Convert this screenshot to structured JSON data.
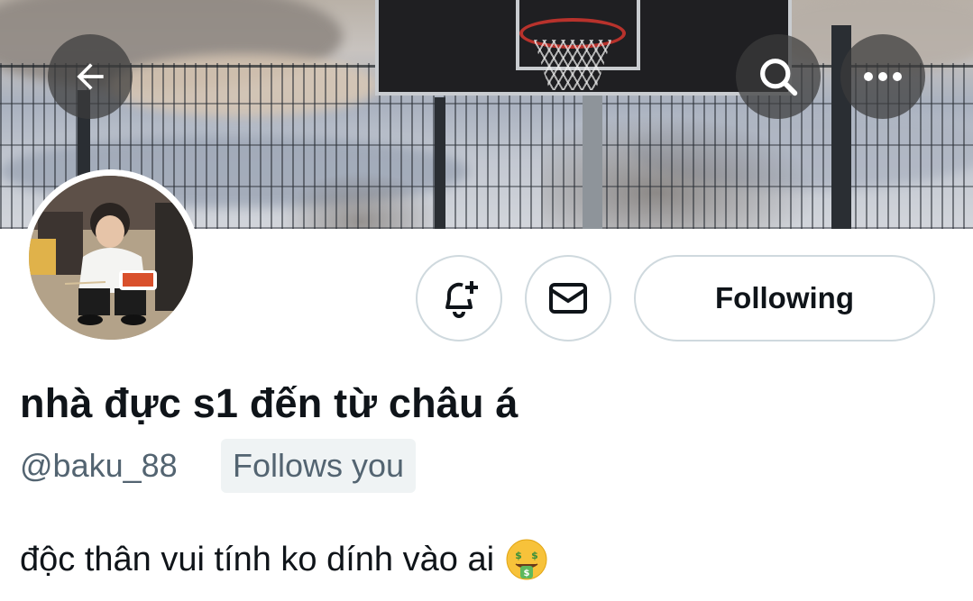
{
  "header": {
    "back_icon": "arrow-left-icon",
    "search_icon": "search-icon",
    "more_icon": "more-horizontal-icon"
  },
  "profile": {
    "display_name": "nhà đực s1 đến từ châu á",
    "handle": "@baku_88",
    "follows_you_badge": "Follows you",
    "bio_text": "độc thân vui tính ko dính vào ai",
    "bio_emoji": "money-mouth-face-emoji"
  },
  "actions": {
    "notifications_icon": "bell-plus-icon",
    "message_icon": "envelope-icon",
    "following_label": "Following"
  },
  "colors": {
    "text_primary": "#0f1419",
    "text_secondary": "#536471",
    "border": "#cfd9de",
    "badge_bg": "#eff3f4"
  }
}
